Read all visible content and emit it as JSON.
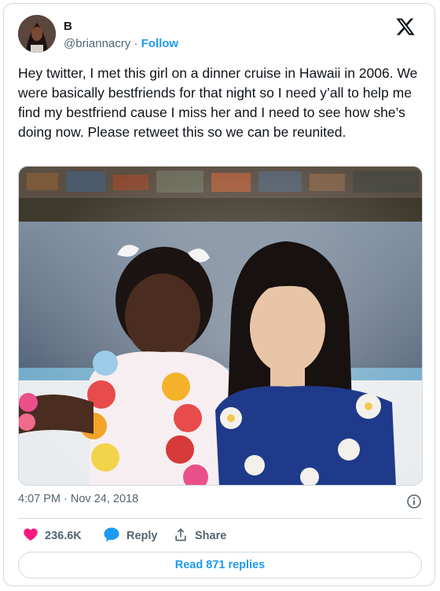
{
  "author": {
    "display_name": "B",
    "handle": "@briannacry",
    "separator": "·",
    "follow_label": "Follow"
  },
  "tweet": {
    "text": "Hey twitter, I met this girl on a dinner cruise in Hawaii in 2006. We were basically bestfriends for that night so I need y’all to help me find my bestfriend cause I miss her and I need to see how she’s doing now. Please retweet this so we can be reunited.",
    "timestamp": "4:07 PM · Nov 24, 2018",
    "photo_description": "photo"
  },
  "actions": {
    "likes_count": "236.6K",
    "reply_label": "Reply",
    "share_label": "Share",
    "read_replies_label": "Read 871 replies"
  },
  "colors": {
    "accent": "#1d9bf0",
    "like": "#f91880",
    "text": "#0f1419",
    "secondary": "#536471"
  },
  "icons": {
    "logo": "x-logo-icon",
    "info": "info-icon",
    "like": "heart-icon",
    "reply": "reply-bubble-icon",
    "share": "share-icon"
  }
}
